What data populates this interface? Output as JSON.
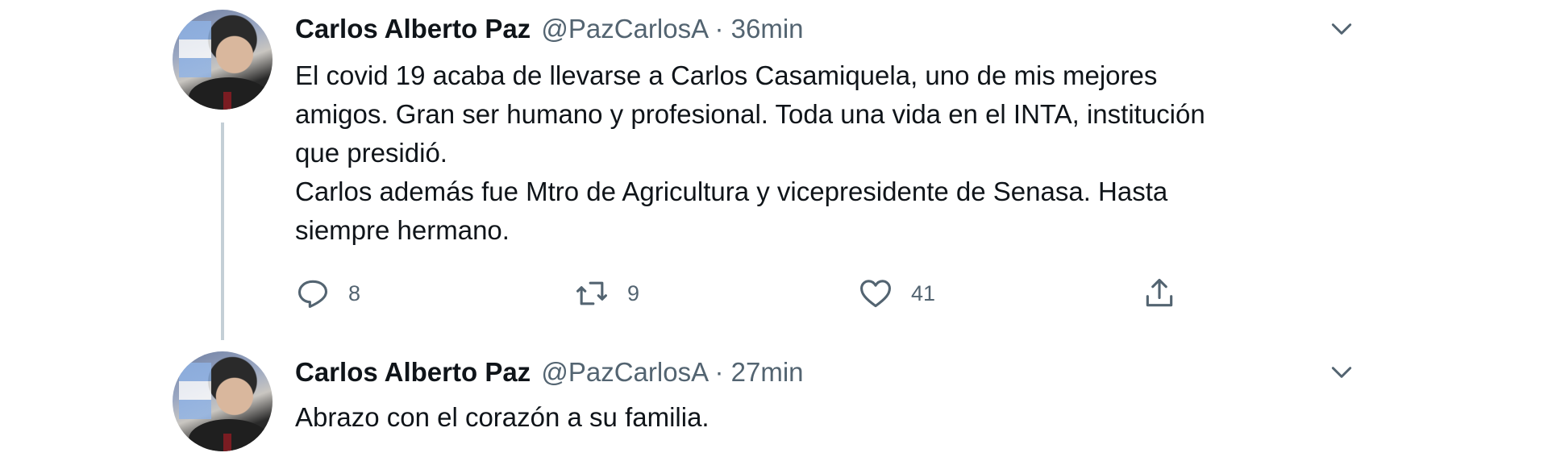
{
  "tweets": [
    {
      "author_name": "Carlos Alberto Paz",
      "handle": "@PazCarlosA",
      "separator": "·",
      "time": "36min",
      "body_lines": [
        "El covid 19 acaba de llevarse a Carlos Casamiquela, uno de mis mejores",
        "amigos. Gran ser humano y profesional. Toda una vida en el INTA, institución",
        "que presidió.",
        "Carlos además fue Mtro de Agricultura y vicepresidente de Senasa. Hasta",
        "siempre hermano."
      ],
      "actions": {
        "reply_count": "8",
        "retweet_count": "9",
        "like_count": "41",
        "reply_icon": "reply-icon",
        "retweet_icon": "retweet-icon",
        "like_icon": "heart-icon",
        "share_icon": "share-icon"
      }
    },
    {
      "author_name": "Carlos Alberto Paz",
      "handle": "@PazCarlosA",
      "separator": "·",
      "time": "27min",
      "body_lines": [
        "Abrazo con el corazón a su familia."
      ]
    }
  ],
  "colors": {
    "text_primary": "#0f1419",
    "text_secondary": "#536471",
    "thread_line": "#c4cfd6"
  }
}
